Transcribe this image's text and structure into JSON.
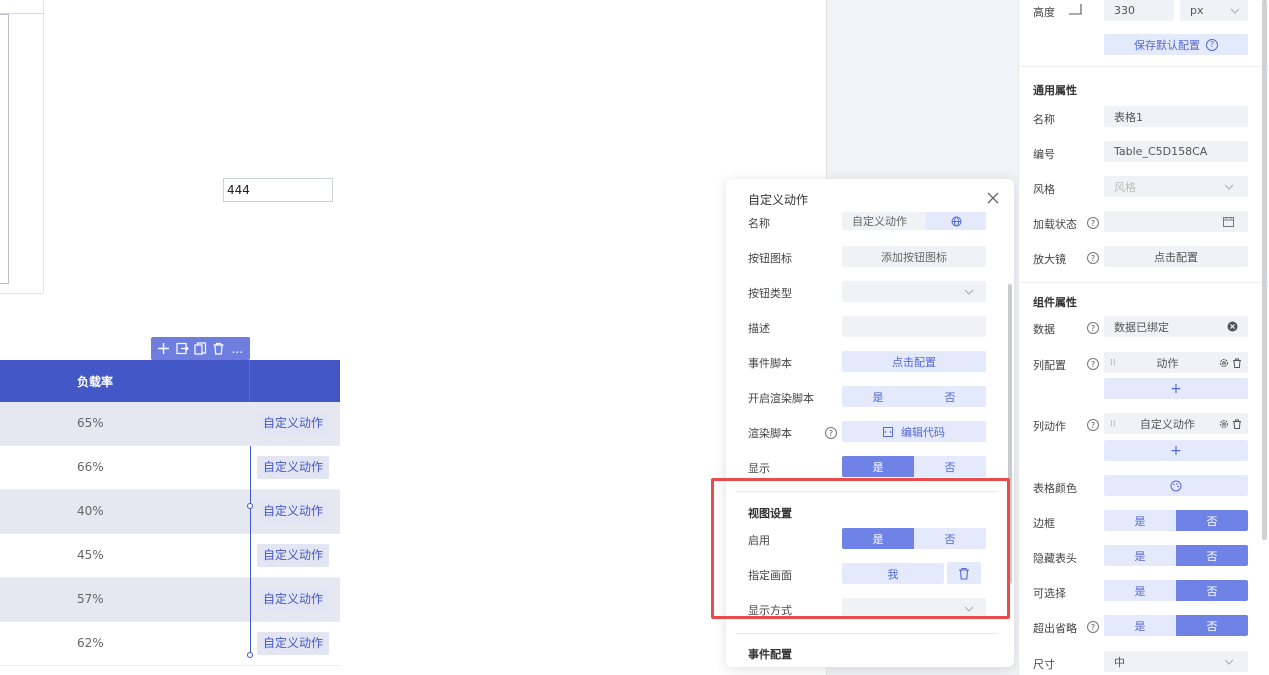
{
  "canvas": {
    "input_value": "444",
    "table": {
      "header_col": "负载率",
      "rows": [
        {
          "pct": "65%",
          "action": "自定义动作"
        },
        {
          "pct": "66%",
          "action": "自定义动作"
        },
        {
          "pct": "40%",
          "action": "自定义动作"
        },
        {
          "pct": "45%",
          "action": "自定义动作"
        },
        {
          "pct": "57%",
          "action": "自定义动作"
        },
        {
          "pct": "62%",
          "action": "自定义动作"
        }
      ]
    },
    "toolbar_more": "..."
  },
  "modal": {
    "title": "自定义动作",
    "name_label": "名称",
    "name_value": "自定义动作",
    "button_icon_label": "按钮图标",
    "button_icon_value": "添加按钮图标",
    "button_type_label": "按钮类型",
    "desc_label": "描述",
    "event_script_label": "事件脚本",
    "event_script_value": "点击配置",
    "enable_render_label": "开启渲染脚本",
    "render_script_label": "渲染脚本",
    "render_script_value": "编辑代码",
    "display_label": "显示",
    "yes": "是",
    "no": "否",
    "view_section": "视图设置",
    "enable_label": "启用",
    "target_view_label": "指定画面",
    "target_view_value": "我",
    "display_mode_label": "显示方式",
    "event_section": "事件配置"
  },
  "panel": {
    "height_label": "高度",
    "height_value": "330",
    "height_unit": "px",
    "save_default": "保存默认配置",
    "common_section": "通用属性",
    "name_label": "名称",
    "name_value": "表格1",
    "id_label": "编号",
    "id_value": "Table_C5D158CA",
    "style_label": "风格",
    "style_placeholder": "风格",
    "loading_label": "加载状态",
    "magnifier_label": "放大镜",
    "magnifier_value": "点击配置",
    "component_section": "组件属性",
    "data_label": "数据",
    "data_value": "数据已绑定",
    "column_config_label": "列配置",
    "column_config_item": "动作",
    "column_action_label": "列动作",
    "column_action_item": "自定义动作",
    "add": "+",
    "table_color_label": "表格颜色",
    "border_label": "边框",
    "hide_header_label": "隐藏表头",
    "selectable_label": "可选择",
    "ellipsis_label": "超出省略",
    "size_label": "尺寸",
    "size_value": "中",
    "yes": "是",
    "no": "否"
  }
}
